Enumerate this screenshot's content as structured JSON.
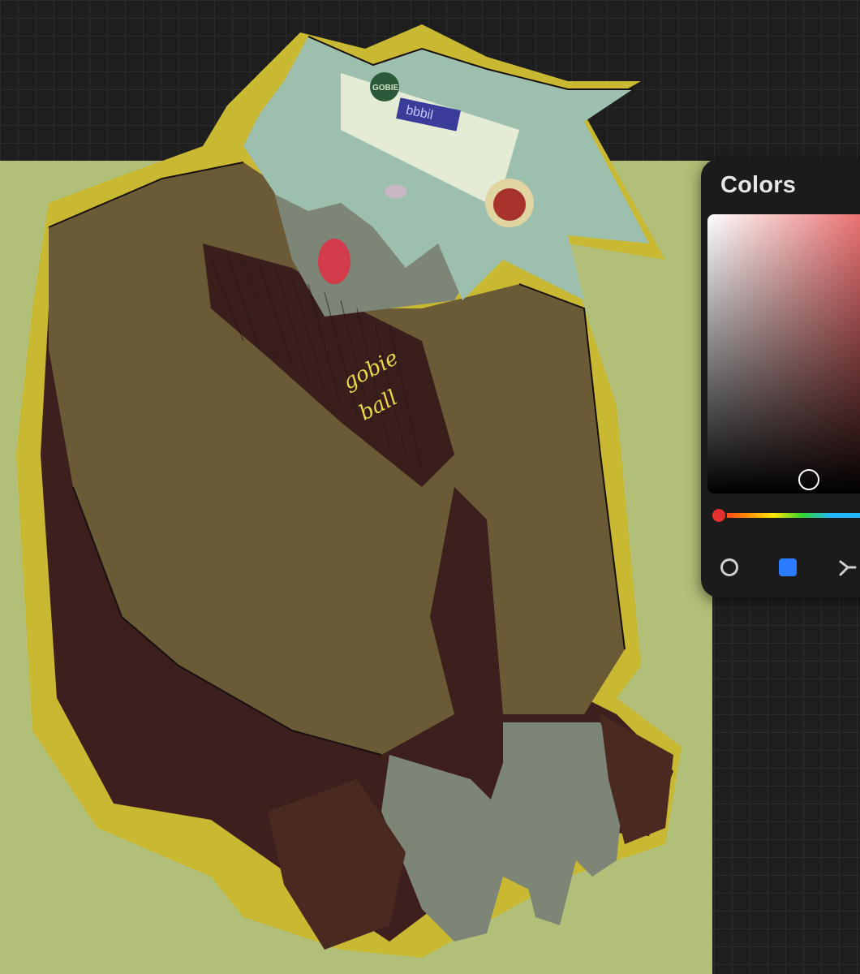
{
  "canvas": {
    "background_color": "#b2bf78",
    "workspace_color": "#1e1e1e"
  },
  "artwork": {
    "subject": "sketch of crouching spiky-haired character",
    "headband_text": "GOBIE",
    "headband_tag_text": "bbbil",
    "signature_line1": "gobie",
    "signature_line2": "ball",
    "hair_color": "#9dbfae",
    "jacket_color": "#6b5a36",
    "pants_color": "#3d1f1d",
    "skin_color": "#7d8676",
    "outline_color": "#c8b832"
  },
  "colors_panel": {
    "title": "Colors",
    "current_hue_color": "#e85a5a",
    "modes": [
      {
        "name": "disc",
        "icon": "color-disc-icon"
      },
      {
        "name": "classic",
        "icon": "classic-square-icon",
        "active": true
      },
      {
        "name": "harmony",
        "icon": "harmony-icon"
      }
    ]
  }
}
